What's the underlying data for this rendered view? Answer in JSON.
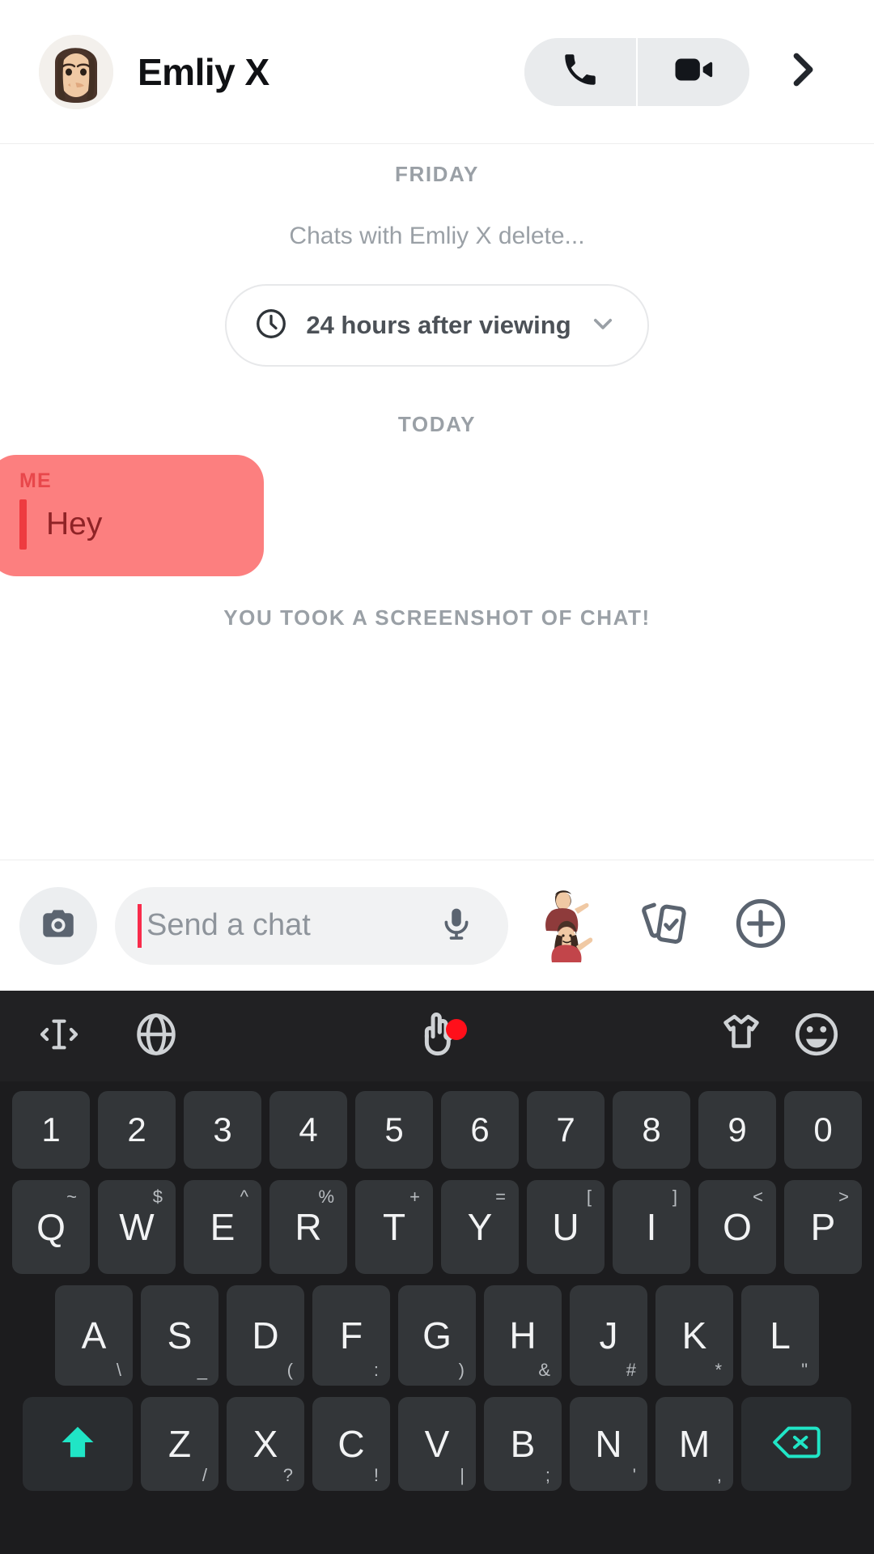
{
  "header": {
    "contact_name": "Emliy X",
    "avatar_name": "bitmoji-avatar",
    "call_icon": "phone-icon",
    "video_icon": "video-camera-icon",
    "chevron_icon": "chevron-right-icon"
  },
  "chat": {
    "day_divider_1": "FRIDAY",
    "delete_note": "Chats with Emliy X delete...",
    "delete_pill_label": "24 hours after viewing",
    "pill_clock_icon": "clock-icon",
    "pill_chevron_icon": "chevron-down-icon",
    "day_divider_2": "TODAY",
    "message": {
      "sender_label": "ME",
      "text": "Hey",
      "bubble_color": "#fc7f7f",
      "accent_color": "#ee3b40",
      "text_color": "#8f2326"
    },
    "screenshot_note": "YOU TOOK A SCREENSHOT OF CHAT!"
  },
  "input_bar": {
    "camera_icon": "camera-icon",
    "placeholder": "Send a chat",
    "mic_icon": "microphone-icon",
    "bitmoji_icon": "bitmoji-sticker-icon",
    "cards_icon": "cards-stickers-icon",
    "plus_icon": "plus-circle-icon",
    "caret_color": "#f92c4b"
  },
  "keyboard": {
    "toolbar": [
      {
        "name": "text-cursor-icon",
        "badge": false
      },
      {
        "name": "globe-language-icon",
        "badge": false
      },
      {
        "name": "hand-gesture-icon",
        "badge": true
      },
      {
        "name": "shirt-theme-icon",
        "badge": false
      },
      {
        "name": "emoji-face-icon",
        "badge": false
      }
    ],
    "badge_color": "#ff0f1a",
    "accent_color": "#20e5c6",
    "rows": {
      "numbers": [
        "1",
        "2",
        "3",
        "4",
        "5",
        "6",
        "7",
        "8",
        "9",
        "0"
      ],
      "qwerty": [
        {
          "main": "Q",
          "sub": "~"
        },
        {
          "main": "W",
          "sub": "$"
        },
        {
          "main": "E",
          "sub": "^"
        },
        {
          "main": "R",
          "sub": "%"
        },
        {
          "main": "T",
          "sub": "+"
        },
        {
          "main": "Y",
          "sub": "="
        },
        {
          "main": "U",
          "sub": "["
        },
        {
          "main": "I",
          "sub": "]"
        },
        {
          "main": "O",
          "sub": "<"
        },
        {
          "main": "P",
          "sub": ">"
        }
      ],
      "asdf": [
        {
          "main": "A",
          "sub": "\\"
        },
        {
          "main": "S",
          "sub": "_"
        },
        {
          "main": "D",
          "sub": "("
        },
        {
          "main": "F",
          "sub": ":"
        },
        {
          "main": "G",
          "sub": ")"
        },
        {
          "main": "H",
          "sub": "&"
        },
        {
          "main": "J",
          "sub": "#"
        },
        {
          "main": "K",
          "sub": "*"
        },
        {
          "main": "L",
          "sub": "\""
        }
      ],
      "zxcv": [
        {
          "main": "Z",
          "sub": "/"
        },
        {
          "main": "X",
          "sub": "?"
        },
        {
          "main": "C",
          "sub": "!"
        },
        {
          "main": "V",
          "sub": "|"
        },
        {
          "main": "B",
          "sub": ";"
        },
        {
          "main": "N",
          "sub": "'"
        },
        {
          "main": "M",
          "sub": ","
        }
      ],
      "shift_icon": "shift-arrow-icon",
      "backspace_icon": "backspace-icon"
    }
  }
}
